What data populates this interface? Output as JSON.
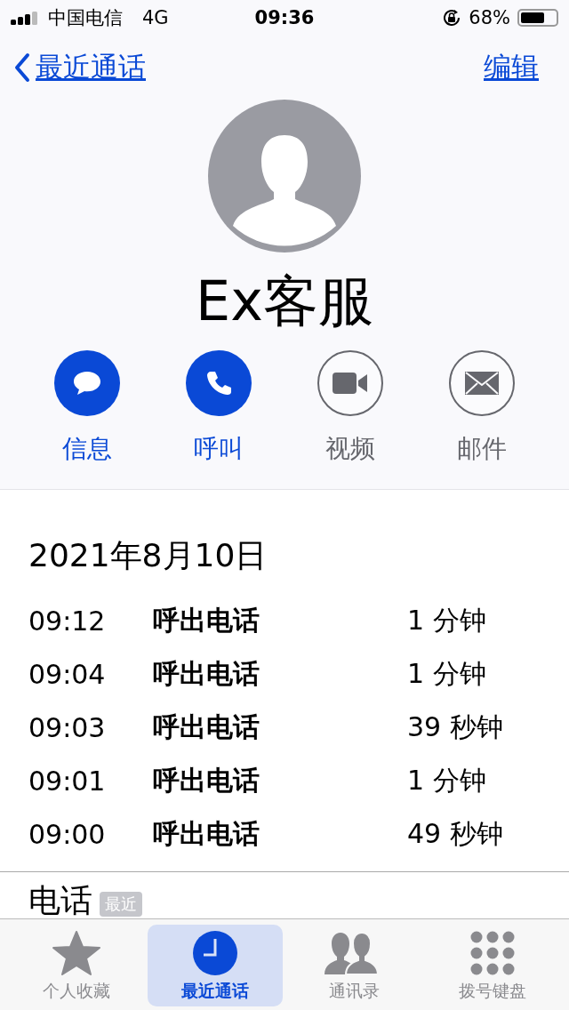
{
  "status_bar": {
    "carrier": "中国电信",
    "network": "4G",
    "time": "09:36",
    "battery_text": "68%"
  },
  "nav": {
    "back": "最近通话",
    "edit": "编辑"
  },
  "contact": {
    "name": "Ex客服"
  },
  "actions": [
    {
      "kind": "message",
      "label": "信息",
      "disabled": false
    },
    {
      "kind": "call",
      "label": "呼叫",
      "disabled": false
    },
    {
      "kind": "video",
      "label": "视频",
      "disabled": true
    },
    {
      "kind": "mail",
      "label": "邮件",
      "disabled": true
    }
  ],
  "calls": {
    "date": "2021年8月10日",
    "rows": [
      {
        "time": "09:12",
        "type": "呼出电话",
        "duration": "1 分钟"
      },
      {
        "time": "09:04",
        "type": "呼出电话",
        "duration": "1 分钟"
      },
      {
        "time": "09:03",
        "type": "呼出电话",
        "duration": "39 秒钟"
      },
      {
        "time": "09:01",
        "type": "呼出电话",
        "duration": "1 分钟"
      },
      {
        "time": "09:00",
        "type": "呼出电话",
        "duration": "49 秒钟"
      }
    ]
  },
  "phone_section": {
    "title": "电话",
    "badge": "最近"
  },
  "tabs": [
    {
      "kind": "favorites",
      "label": "个人收藏",
      "selected": false
    },
    {
      "kind": "recents",
      "label": "最近通话",
      "selected": true
    },
    {
      "kind": "contacts",
      "label": "通讯录",
      "selected": false
    },
    {
      "kind": "keypad",
      "label": "拨号键盘",
      "selected": false
    }
  ]
}
